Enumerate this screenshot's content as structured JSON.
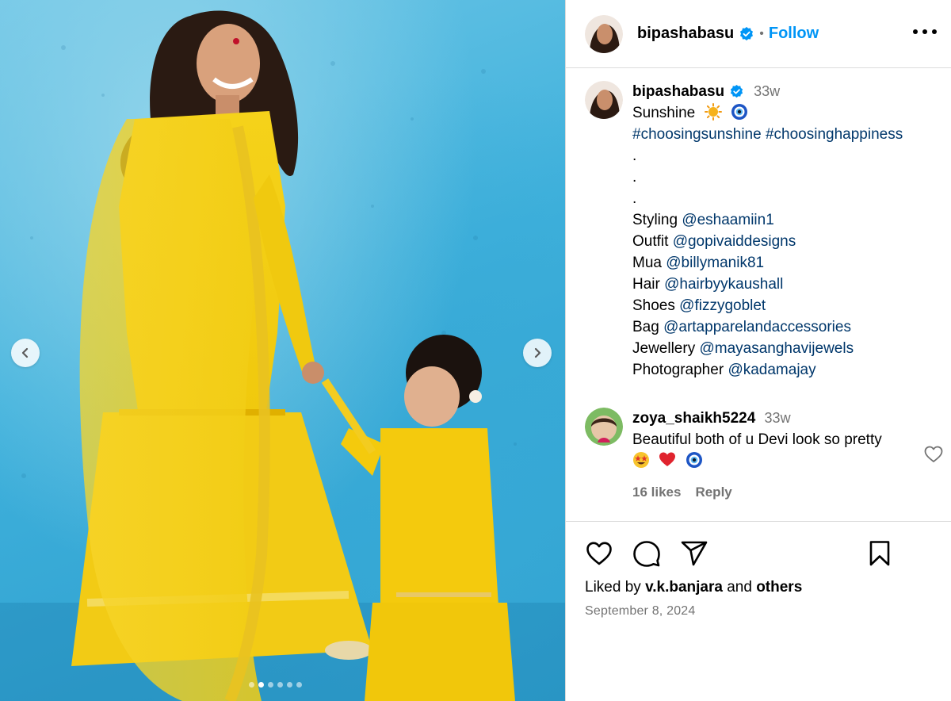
{
  "post": {
    "username": "bipashabasu",
    "follow_label": "Follow",
    "separator": "•",
    "caption": {
      "time": "33w",
      "first_line": "Sunshine",
      "emojis": [
        "sun-emoji",
        "nazar-amulet-emoji"
      ],
      "hashtags": "#choosingsunshine #choosinghappiness",
      "dots": [
        ".",
        ".",
        "."
      ],
      "credits": [
        {
          "label": "Styling",
          "handle": "@eshaamiin1"
        },
        {
          "label": "Outfit",
          "handle": "@gopivaiddesigns"
        },
        {
          "label": "Mua",
          "handle": "@billymanik81"
        },
        {
          "label": "Hair",
          "handle": "@hairbyykaushall"
        },
        {
          "label": "Shoes",
          "handle": "@fizzygoblet"
        },
        {
          "label": "Bag",
          "handle": "@artapparelandaccessories"
        },
        {
          "label": "Jewellery",
          "handle": "@mayasanghavijewels"
        },
        {
          "label": "Photographer",
          "handle": "@kadamajay"
        }
      ]
    },
    "comment": {
      "username": "zoya_shaikh5224",
      "time": "33w",
      "text": "Beautiful both of u Devi look so pretty",
      "emojis": [
        "star-struck-emoji",
        "red-heart-emoji",
        "nazar-amulet-emoji"
      ],
      "likes": "16 likes",
      "reply": "Reply"
    },
    "liked_by": {
      "prefix": "Liked by",
      "user": "v.k.banjara",
      "and": "and",
      "others": "others"
    },
    "date": "September 8, 2024",
    "carousel": {
      "slide_count": 6,
      "active_index": 1
    }
  },
  "colors": {
    "link": "#00376b",
    "follow": "#0095f6",
    "muted": "#737373",
    "border": "#dbdbdb"
  }
}
